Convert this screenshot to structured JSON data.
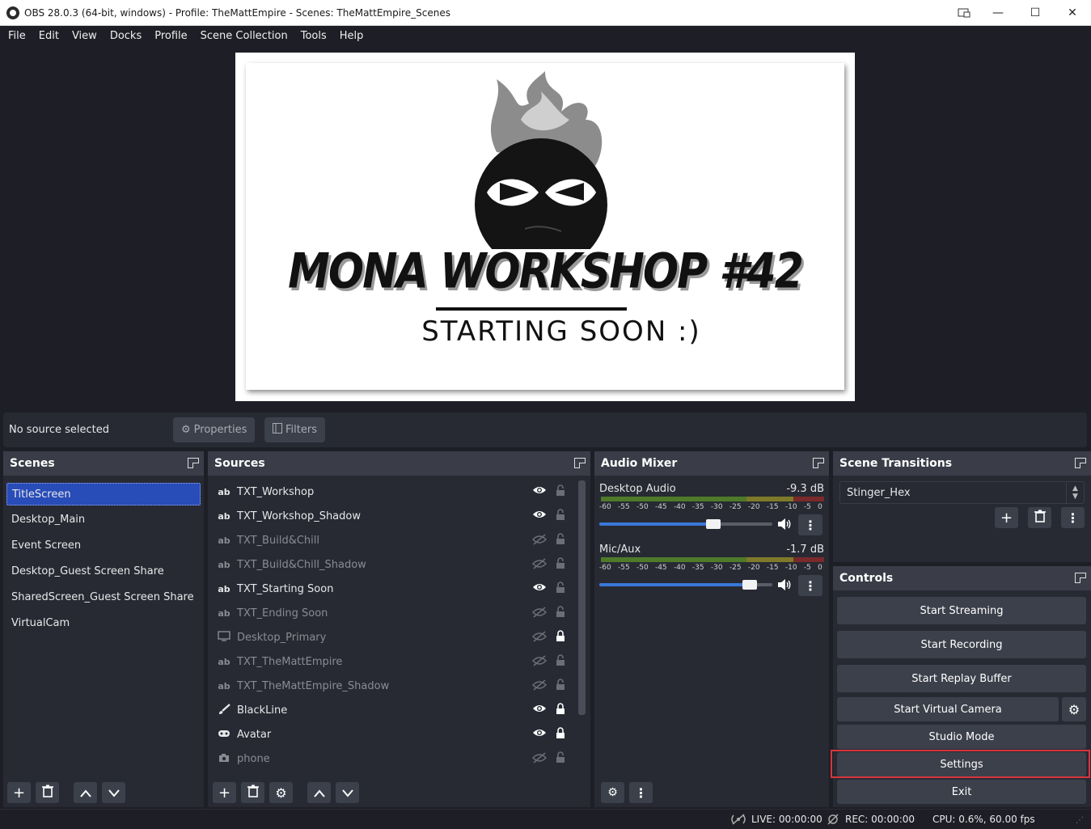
{
  "window": {
    "title": "OBS 28.0.3 (64-bit, windows) - Profile: TheMattEmpire - Scenes: TheMattEmpire_Scenes",
    "minimize": "—",
    "maximize": "☐",
    "close": "✕"
  },
  "menu": [
    "File",
    "Edit",
    "View",
    "Docks",
    "Profile",
    "Scene Collection",
    "Tools",
    "Help"
  ],
  "preview": {
    "headline": "MONA WORKSHOP #42",
    "subtitle": "STARTING SOON :)"
  },
  "source_toolbar": {
    "status": "No source selected",
    "properties": "Properties",
    "filters": "Filters"
  },
  "scenes": {
    "title": "Scenes",
    "items": [
      "TitleScreen",
      "Desktop_Main",
      "Event Screen",
      "Desktop_Guest Screen Share",
      "SharedScreen_Guest Screen Share",
      "VirtualCam"
    ],
    "selected": "TitleScreen"
  },
  "sources": {
    "title": "Sources",
    "items": [
      {
        "name": "TXT_Workshop",
        "icon": "text-icon",
        "visible": true,
        "locked": false
      },
      {
        "name": "TXT_Workshop_Shadow",
        "icon": "text-icon",
        "visible": true,
        "locked": false
      },
      {
        "name": "TXT_Build&Chill",
        "icon": "text-icon",
        "visible": false,
        "locked": false
      },
      {
        "name": "TXT_Build&Chill_Shadow",
        "icon": "text-icon",
        "visible": false,
        "locked": false
      },
      {
        "name": "TXT_Starting Soon",
        "icon": "text-icon",
        "visible": true,
        "locked": false
      },
      {
        "name": "TXT_Ending Soon",
        "icon": "text-icon",
        "visible": false,
        "locked": false
      },
      {
        "name": "Desktop_Primary",
        "icon": "monitor-icon",
        "visible": false,
        "locked": true
      },
      {
        "name": "TXT_TheMattEmpire",
        "icon": "text-icon",
        "visible": false,
        "locked": false
      },
      {
        "name": "TXT_TheMattEmpire_Shadow",
        "icon": "text-icon",
        "visible": false,
        "locked": false
      },
      {
        "name": "BlackLine",
        "icon": "brush-icon",
        "visible": true,
        "locked": true
      },
      {
        "name": "Avatar",
        "icon": "gamepad-icon",
        "visible": true,
        "locked": true
      },
      {
        "name": "phone",
        "icon": "camera-icon",
        "visible": false,
        "locked": false
      }
    ]
  },
  "audio_mixer": {
    "title": "Audio Mixer",
    "ticks": [
      "-60",
      "-55",
      "-50",
      "-45",
      "-40",
      "-35",
      "-30",
      "-25",
      "-20",
      "-15",
      "-10",
      "-5",
      "0"
    ],
    "channels": [
      {
        "name": "Desktop Audio",
        "db": "-9.3 dB",
        "volume": 0.66
      },
      {
        "name": "Mic/Aux",
        "db": "-1.7 dB",
        "volume": 0.87
      }
    ]
  },
  "scene_transitions": {
    "title": "Scene Transitions",
    "selected": "Stinger_Hex"
  },
  "controls": {
    "title": "Controls",
    "start_streaming": "Start Streaming",
    "start_recording": "Start Recording",
    "start_replay_buffer": "Start Replay Buffer",
    "start_virtual_camera": "Start Virtual Camera",
    "studio_mode": "Studio Mode",
    "settings": "Settings",
    "exit": "Exit"
  },
  "status_bar": {
    "live": "LIVE: 00:00:00",
    "rec": "REC: 00:00:00",
    "cpu": "CPU: 0.6%, 60.00 fps"
  },
  "colors": {
    "accent": "#284cb8",
    "highlight": "#d9363e",
    "slider": "#3a78d8"
  }
}
